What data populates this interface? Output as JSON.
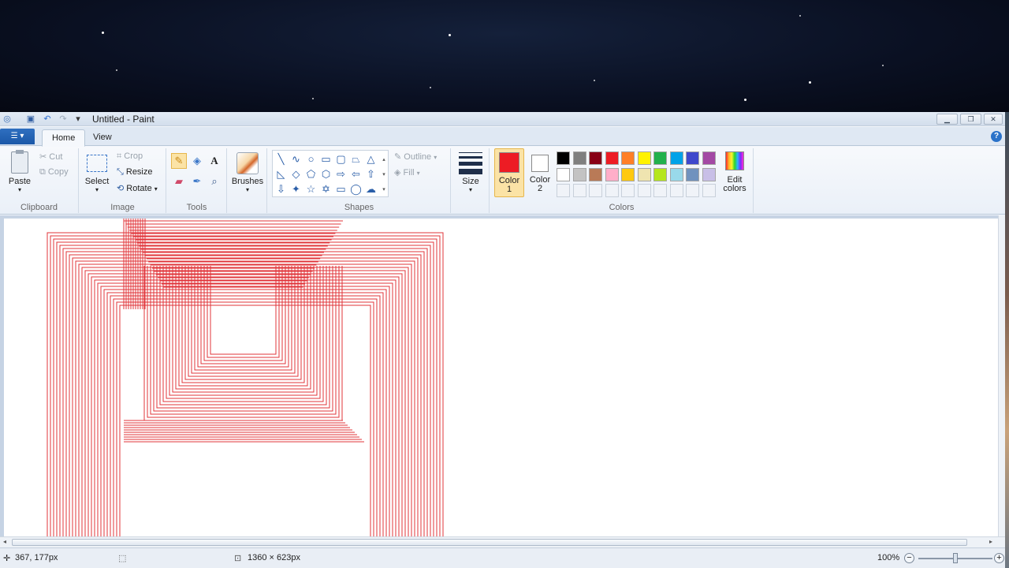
{
  "window": {
    "title": "Untitled - Paint"
  },
  "tabs": [
    {
      "label": "Home",
      "active": true
    },
    {
      "label": "View",
      "active": false
    }
  ],
  "clipboard": {
    "paste_label": "Paste",
    "cut_label": "Cut",
    "copy_label": "Copy",
    "group_label": "Clipboard"
  },
  "image": {
    "select_label": "Select",
    "crop_label": "Crop",
    "resize_label": "Resize",
    "rotate_label": "Rotate",
    "group_label": "Image"
  },
  "tools": {
    "group_label": "Tools",
    "selected": "pencil"
  },
  "brushes": {
    "label": "Brushes"
  },
  "shapes": {
    "group_label": "Shapes",
    "outline_label": "Outline",
    "fill_label": "Fill"
  },
  "size": {
    "label": "Size"
  },
  "colors": {
    "color1_label_line1": "Color",
    "color1_label_line2": "1",
    "color2_label_line1": "Color",
    "color2_label_line2": "2",
    "color1_value": "#ed1c24",
    "color2_value": "#ffffff",
    "edit_label_line1": "Edit",
    "edit_label_line2": "colors",
    "group_label": "Colors",
    "palette_row1": [
      "#000000",
      "#7f7f7f",
      "#880015",
      "#ed1c24",
      "#ff7f27",
      "#fff200",
      "#22b14c",
      "#00a2e8",
      "#3f48cc",
      "#a349a4"
    ],
    "palette_row2": [
      "#ffffff",
      "#c3c3c3",
      "#b97a57",
      "#ffaec9",
      "#ffc90e",
      "#efe4b0",
      "#b5e61d",
      "#99d9ea",
      "#7092be",
      "#c8bfe7"
    ]
  },
  "status": {
    "cursor_position": "367, 177px",
    "image_size": "1360 × 623px",
    "zoom": "100%",
    "zoom_level": 0.5
  }
}
